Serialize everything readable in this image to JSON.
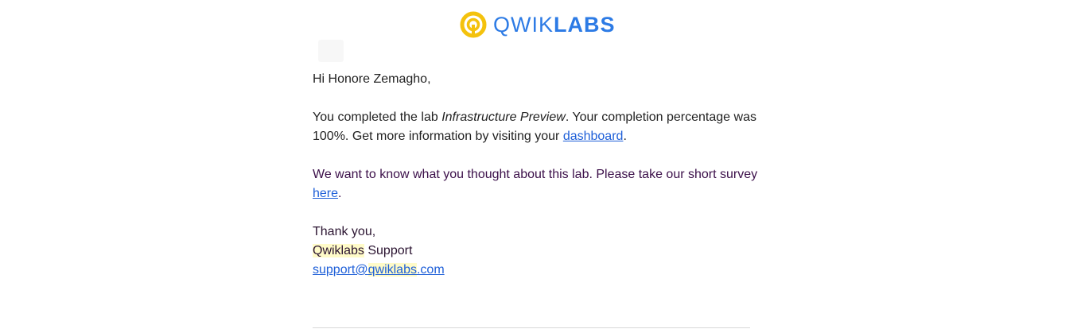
{
  "brand": {
    "name_light": "QWIK",
    "name_bold": "LABS",
    "logo_icon": "qwiklabs-logo-icon",
    "colors": {
      "logo_ring": "#f4c20d",
      "logo_text": "#2d7be5",
      "link": "#1e5fd8",
      "highlight": "#fffbc8"
    }
  },
  "email": {
    "greeting": "Hi Honore Zemagho,",
    "para1": {
      "before_lab": "You completed the lab ",
      "lab_name": "Infrastructure Preview",
      "after_lab": ". Your completion percentage was 100%. Get more information by visiting your ",
      "dashboard_link": "dashboard",
      "end": "."
    },
    "para2": {
      "text": "We want to know what you thought about this lab. Please take our short survey ",
      "survey_link": "here",
      "end": "."
    },
    "signoff": {
      "thanks": "Thank you,",
      "team_highlight": "Qwiklabs",
      "team_rest": " Support",
      "email_prefix": "support@",
      "email_highlight": "qwiklabs",
      "email_suffix": ".com"
    }
  }
}
